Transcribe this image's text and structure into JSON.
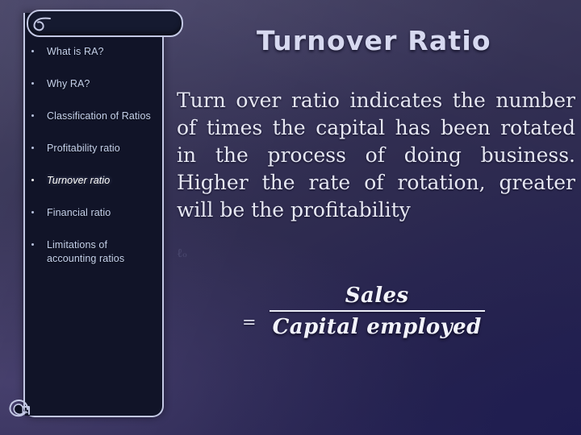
{
  "slide": {
    "title": "Turnover Ratio",
    "body": "Turn over ratio indicates the number of times the capital has been rotated in the process of doing business. Higher the rate of rotation, greater will be the profitability",
    "artifact_mark": "ℓₒ"
  },
  "formula": {
    "equals": "=",
    "numerator": "Sales",
    "denominator": "Capital employed"
  },
  "sidebar": {
    "items": [
      {
        "label": "What is RA?",
        "active": false
      },
      {
        "label": "Why RA?",
        "active": false
      },
      {
        "label": "Classification of Ratios",
        "active": false
      },
      {
        "label": "Profitability ratio",
        "active": false
      },
      {
        "label": "Turnover ratio",
        "active": true
      },
      {
        "label": "Financial ratio",
        "active": false
      },
      {
        "label": "Limitations of accounting ratios",
        "active": false
      }
    ]
  },
  "colors": {
    "background_top_left": "#3f3c5e",
    "background_bottom_right": "#25235a",
    "panel_fill": "#111428",
    "panel_stroke": "#c3c8e4",
    "toc_text": "#c6d2ec",
    "toc_active_text": "#ffffff",
    "title_text": "#d7d9f0",
    "body_text": "#e6e7f3"
  },
  "icons": {
    "scroll_curl_top": "scroll-curl-top-icon",
    "scroll_curl_bottom": "scroll-curl-bottom-icon",
    "bullet": "bullet-dot-icon"
  }
}
